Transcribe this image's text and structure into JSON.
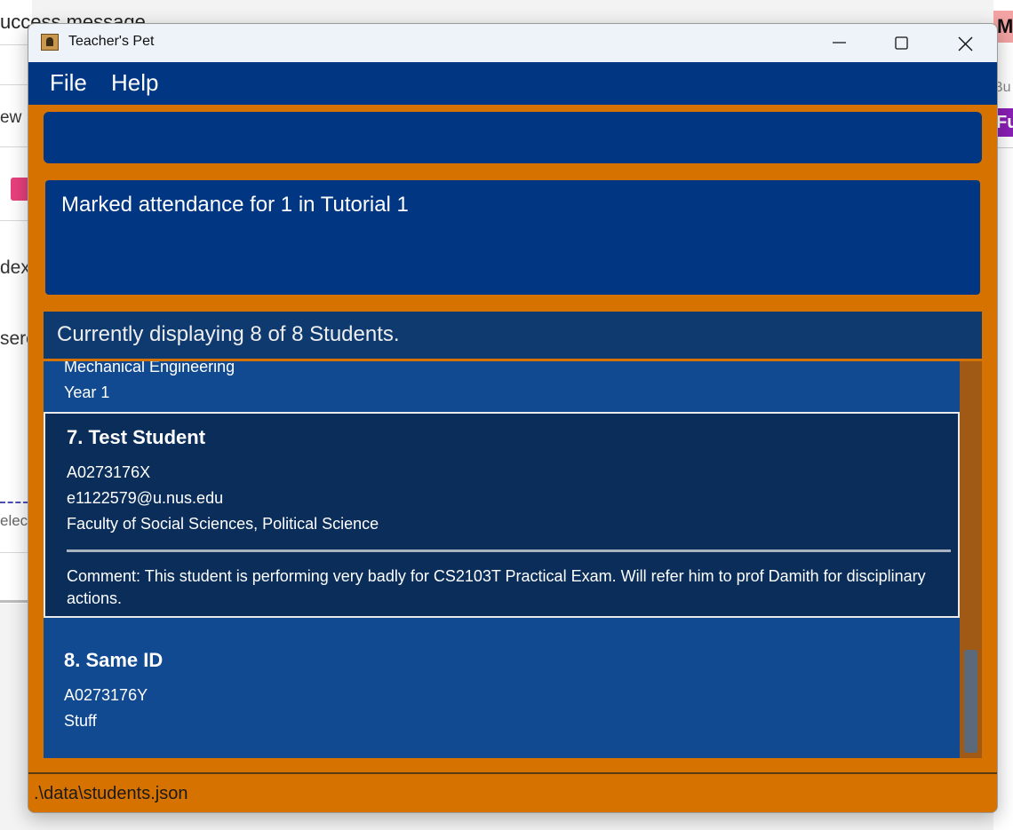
{
  "background": {
    "title_fragment": "uccess message",
    "snippets": [
      "ew",
      "dex",
      "serc",
      "elect"
    ],
    "right_badge": "M",
    "right_label": "Bu",
    "right_button": "Fu"
  },
  "window": {
    "title": "Teacher's Pet",
    "controls": [
      "minimize",
      "maximize",
      "close"
    ]
  },
  "menu": {
    "items": [
      "File",
      "Help"
    ]
  },
  "command": {
    "value": "",
    "placeholder": ""
  },
  "result": {
    "message": "Marked attendance for 1 in Tutorial 1"
  },
  "student_list": {
    "header": "Currently displaying 8 of 8 Students.",
    "partial_card": {
      "line1": "Mechanical Engineering",
      "line2": "Year 1"
    },
    "selected_card": {
      "name": "7. Test Student",
      "student_id": "A0273176X",
      "email": "e1122579@u.nus.edu",
      "faculty": "Faculty of Social Sciences, Political Science",
      "comment": "Comment: This student is performing very badly for CS2103T Practical Exam. Will refer him to prof Damith for disciplinary actions."
    },
    "last_card": {
      "name": "8. Same ID",
      "student_id": "A0273176Y",
      "line2": "Stuff"
    }
  },
  "status": {
    "file_path": ".\\data\\students.json"
  },
  "colors": {
    "accent_orange": "#d67200",
    "panel_blue": "#003682",
    "card_blue": "#124a92",
    "selected_card": "#0a2d5a"
  }
}
